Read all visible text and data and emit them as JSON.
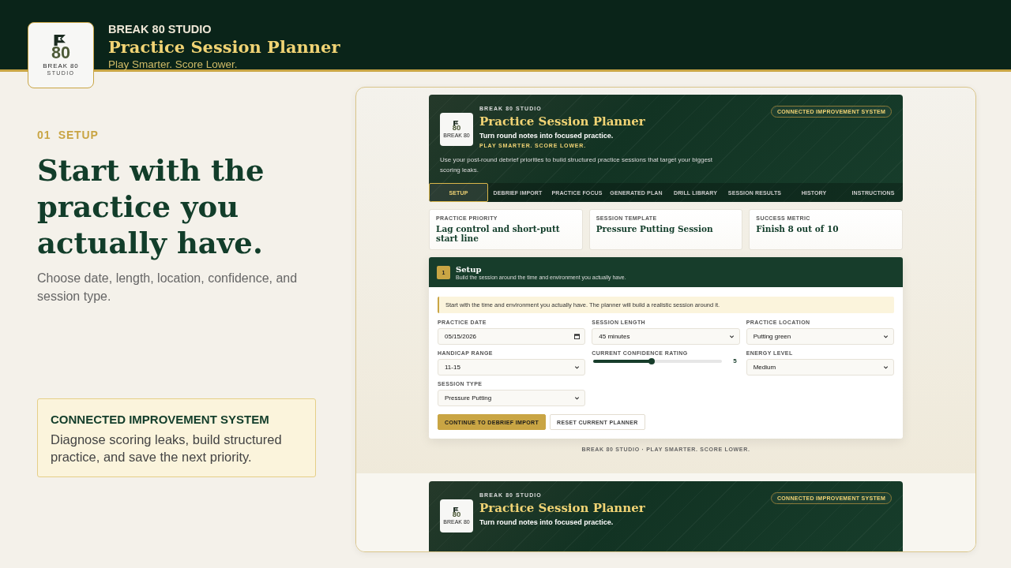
{
  "top_bar": {
    "logo": {
      "mark": "80",
      "name": "BREAK 80",
      "sub": "STUDIO"
    },
    "brand": "BREAK 80 STUDIO",
    "title": "Practice Session Planner",
    "tagline": "Play Smarter. Score Lower."
  },
  "intro": {
    "step": "01  SETUP",
    "headline": "Start with the practice you actually have.",
    "description": "Choose date, length, location, confidence, and session type.",
    "callout": {
      "title": "CONNECTED IMPROVEMENT SYSTEM",
      "body": "Diagnose scoring leaks, build structured practice, and save the next priority."
    }
  },
  "preview": {
    "header": {
      "logo": {
        "mark": "80",
        "name": "BREAK 80"
      },
      "brand": "BREAK 80 STUDIO",
      "title": "Practice Session Planner",
      "subtitle": "Turn round notes into focused practice.",
      "tagline": "PLAY SMARTER. SCORE LOWER.",
      "description": "Use your post-round debrief priorities to build structured practice sessions that target your biggest scoring leaks.",
      "badge": "CONNECTED IMPROVEMENT SYSTEM"
    },
    "tabs": [
      {
        "label": "SETUP",
        "selected": true
      },
      {
        "label": "DEBRIEF IMPORT",
        "selected": false
      },
      {
        "label": "PRACTICE FOCUS",
        "selected": false
      },
      {
        "label": "GENERATED PLAN",
        "selected": false
      },
      {
        "label": "DRILL LIBRARY",
        "selected": false
      },
      {
        "label": "SESSION RESULTS",
        "selected": false
      },
      {
        "label": "HISTORY",
        "selected": false
      },
      {
        "label": "INSTRUCTIONS",
        "selected": false
      }
    ],
    "summary_cards": [
      {
        "label": "PRACTICE PRIORITY",
        "value": "Lag control and short-putt start line"
      },
      {
        "label": "SESSION TEMPLATE",
        "value": "Pressure Putting Session"
      },
      {
        "label": "SUCCESS METRIC",
        "value": "Finish 8 out of 10"
      }
    ],
    "setup": {
      "step": "1",
      "title": "Setup",
      "subtitle": "Build the session around the time and environment you actually have.",
      "notice": "Start with the time and environment you actually have. The planner will build a realistic session around it.",
      "fields": [
        {
          "kind": "date",
          "label": "PRACTICE DATE",
          "value": "05/15/2026"
        },
        {
          "kind": "select",
          "label": "SESSION LENGTH",
          "value": "45 minutes"
        },
        {
          "kind": "select",
          "label": "PRACTICE LOCATION",
          "value": "Putting green"
        },
        {
          "kind": "select",
          "label": "HANDICAP RANGE",
          "value": "11-15"
        },
        {
          "kind": "slider",
          "label": "CURRENT CONFIDENCE RATING",
          "level": 0.45,
          "reading": "5"
        },
        {
          "kind": "select",
          "label": "ENERGY LEVEL",
          "value": "Medium"
        },
        {
          "kind": "select",
          "label": "SESSION TYPE",
          "value": "Pressure Putting"
        }
      ],
      "buttons": [
        {
          "kind": "primary",
          "label": "CONTINUE TO DEBRIEF IMPORT"
        },
        {
          "kind": "secondary",
          "label": "RESET CURRENT PLANNER"
        }
      ]
    },
    "footer": "BREAK 80 STUDIO · PLAY SMARTER. SCORE LOWER.",
    "second_header": {
      "logo": {
        "mark": "80",
        "name": "BREAK 80"
      },
      "brand": "BREAK 80 STUDIO",
      "title": "Practice Session Planner",
      "subtitle": "Turn round notes into focused practice.",
      "badge": "CONNECTED IMPROVEMENT SYSTEM"
    }
  }
}
